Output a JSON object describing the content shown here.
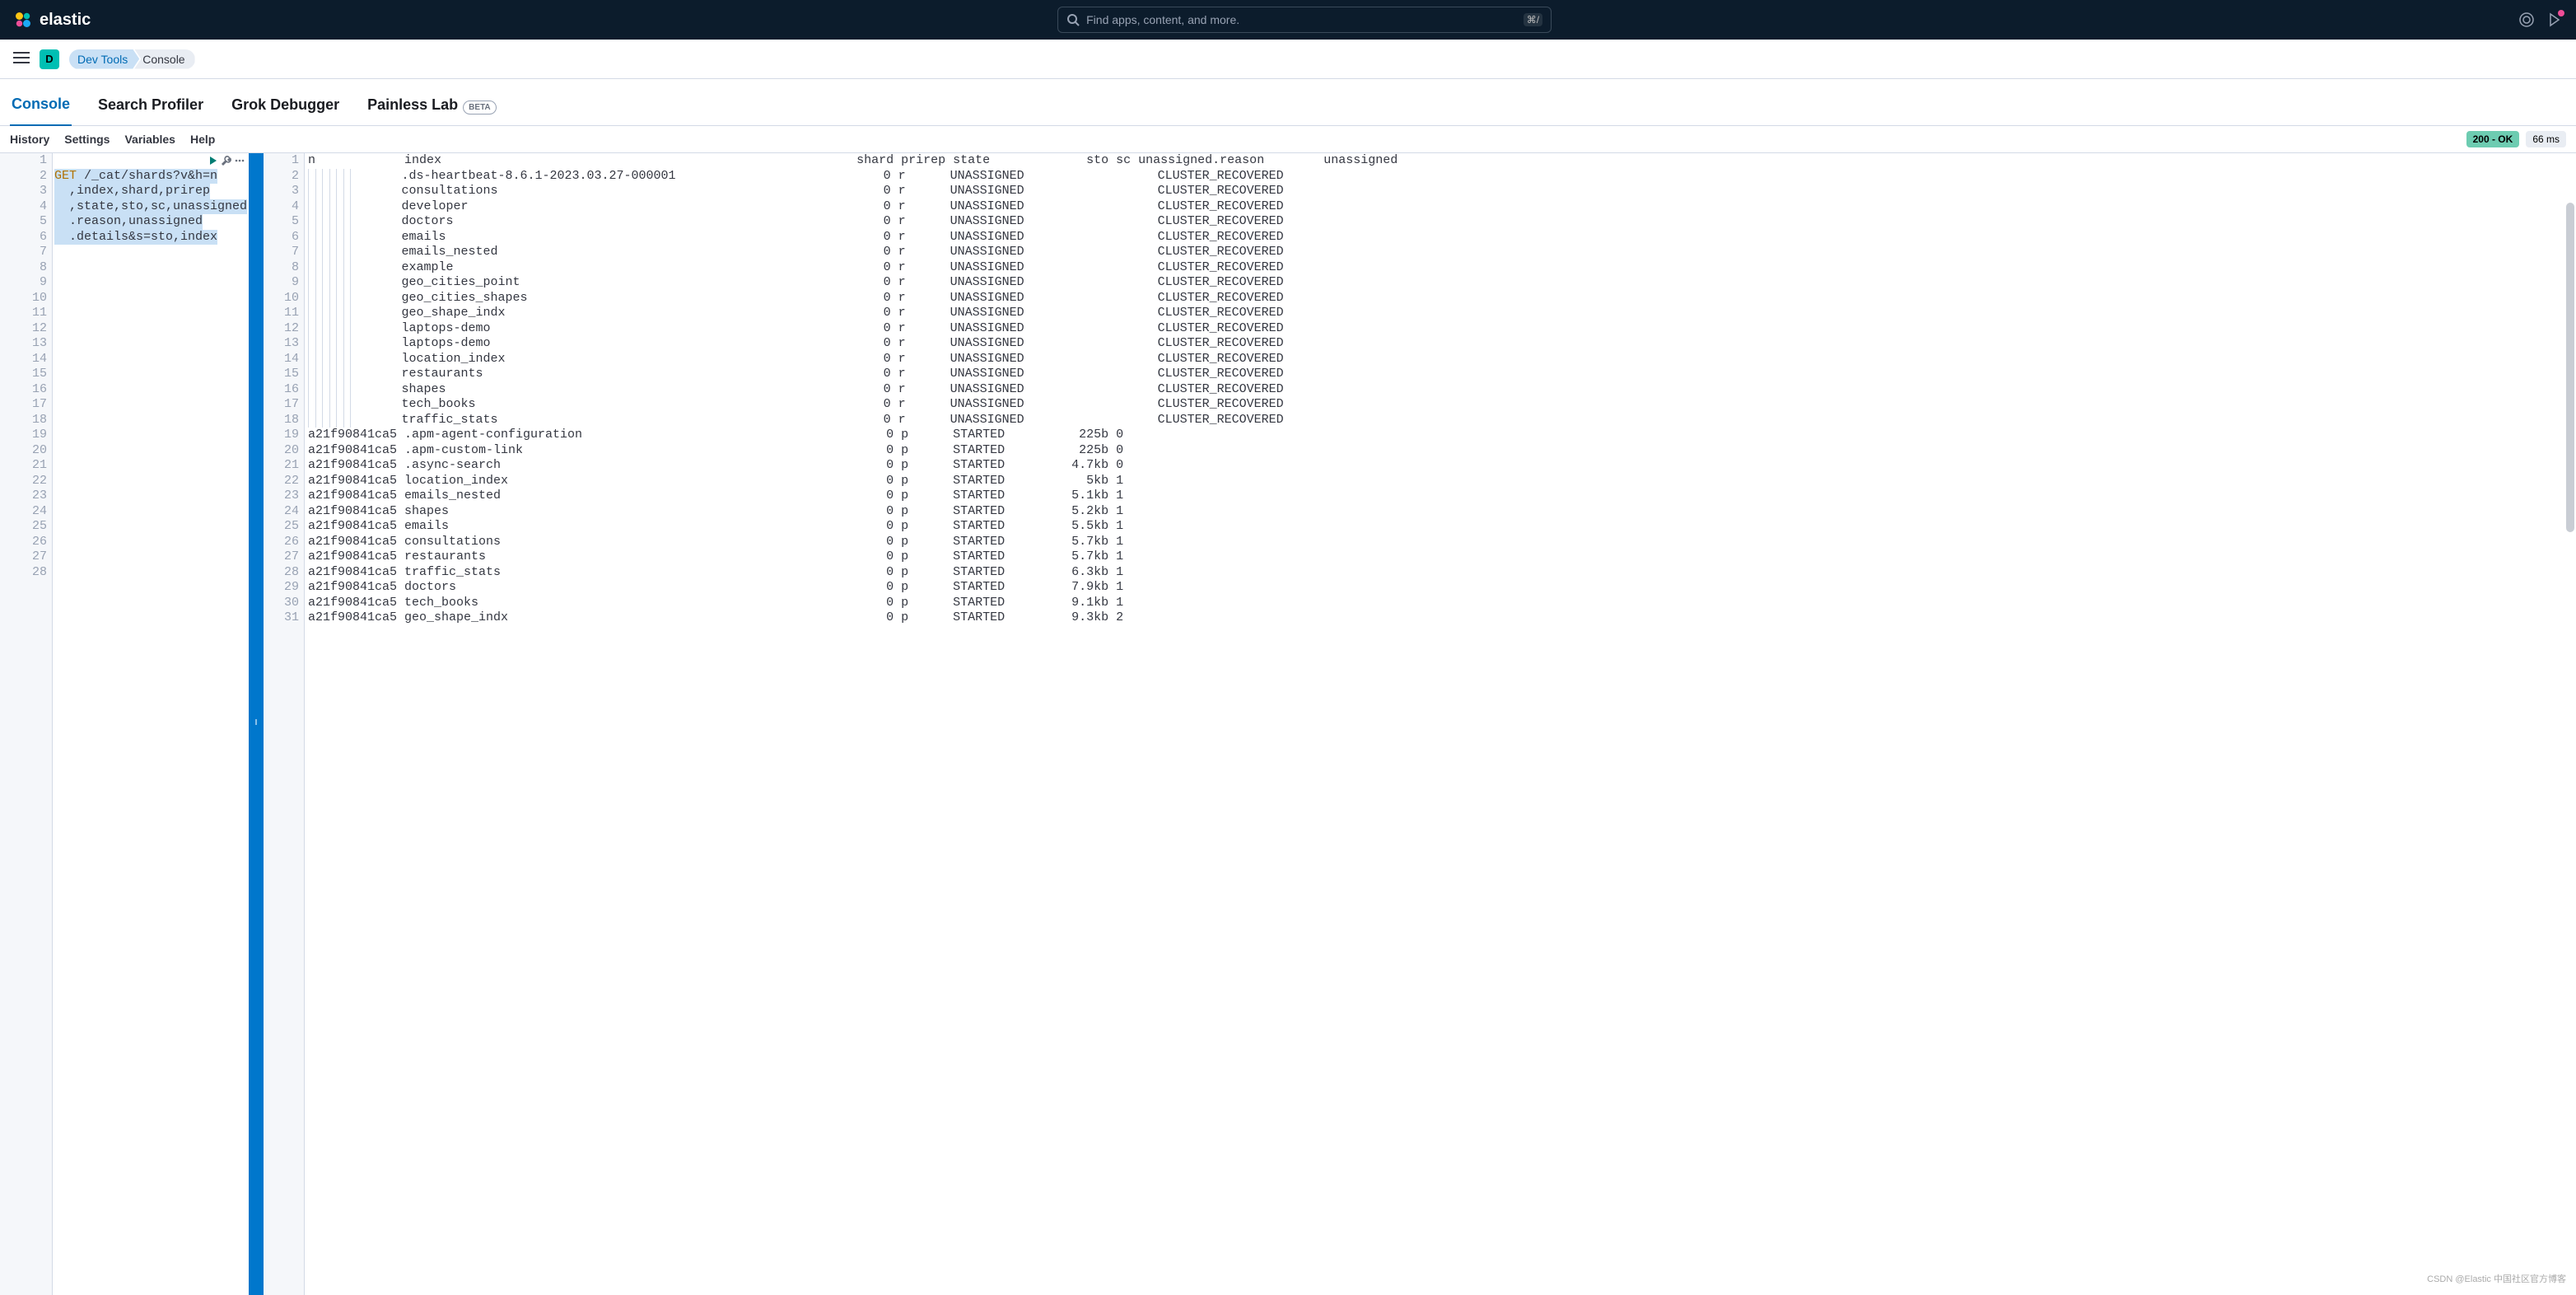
{
  "header": {
    "brand": "elastic",
    "search_placeholder": "Find apps, content, and more.",
    "search_shortcut": "⌘/"
  },
  "subbar": {
    "avatar": "D",
    "breadcrumbs": [
      "Dev Tools",
      "Console"
    ]
  },
  "tabs": {
    "items": [
      "Console",
      "Search Profiler",
      "Grok Debugger",
      "Painless Lab"
    ],
    "beta_label": "BETA",
    "active": 0
  },
  "toolbar": {
    "links": [
      "History",
      "Settings",
      "Variables",
      "Help"
    ],
    "status": "200 - OK",
    "time": "66 ms"
  },
  "request": {
    "total_lines": 28,
    "lines": [
      "",
      {
        "method": "GET",
        "path": " /_cat/shards?v&h=n"
      },
      "  ,index,shard,prirep",
      "  ,state,sto,sc,unassigned",
      "  .reason,unassigned",
      "  .details&s=sto,index"
    ]
  },
  "response": {
    "cols": {
      "n": "n",
      "index": "index",
      "shard": "shard",
      "prirep": "prirep",
      "state": "state",
      "sto": "sto",
      "sc": "sc",
      "ur": "unassigned.reason",
      "ud": "unassigned"
    },
    "header_continuation": ".details",
    "rows": [
      {
        "n": "",
        "index": ".ds-heartbeat-8.6.1-2023.03.27-000001",
        "shard": "0",
        "prirep": "r",
        "state": "UNASSIGNED",
        "sto": "",
        "sc": "",
        "ur": "CLUSTER_RECOVERED",
        "ud": "",
        "indent": true
      },
      {
        "n": "",
        "index": "consultations",
        "shard": "0",
        "prirep": "r",
        "state": "UNASSIGNED",
        "sto": "",
        "sc": "",
        "ur": "CLUSTER_RECOVERED",
        "ud": "",
        "indent": true
      },
      {
        "n": "",
        "index": "developer",
        "shard": "0",
        "prirep": "r",
        "state": "UNASSIGNED",
        "sto": "",
        "sc": "",
        "ur": "CLUSTER_RECOVERED",
        "ud": "",
        "indent": true
      },
      {
        "n": "",
        "index": "doctors",
        "shard": "0",
        "prirep": "r",
        "state": "UNASSIGNED",
        "sto": "",
        "sc": "",
        "ur": "CLUSTER_RECOVERED",
        "ud": "",
        "indent": true
      },
      {
        "n": "",
        "index": "emails",
        "shard": "0",
        "prirep": "r",
        "state": "UNASSIGNED",
        "sto": "",
        "sc": "",
        "ur": "CLUSTER_RECOVERED",
        "ud": "",
        "indent": true
      },
      {
        "n": "",
        "index": "emails_nested",
        "shard": "0",
        "prirep": "r",
        "state": "UNASSIGNED",
        "sto": "",
        "sc": "",
        "ur": "CLUSTER_RECOVERED",
        "ud": "",
        "indent": true
      },
      {
        "n": "",
        "index": "example",
        "shard": "0",
        "prirep": "r",
        "state": "UNASSIGNED",
        "sto": "",
        "sc": "",
        "ur": "CLUSTER_RECOVERED",
        "ud": "",
        "indent": true
      },
      {
        "n": "",
        "index": "geo_cities_point",
        "shard": "0",
        "prirep": "r",
        "state": "UNASSIGNED",
        "sto": "",
        "sc": "",
        "ur": "CLUSTER_RECOVERED",
        "ud": "",
        "indent": true
      },
      {
        "n": "",
        "index": "geo_cities_shapes",
        "shard": "0",
        "prirep": "r",
        "state": "UNASSIGNED",
        "sto": "",
        "sc": "",
        "ur": "CLUSTER_RECOVERED",
        "ud": "",
        "indent": true
      },
      {
        "n": "",
        "index": "geo_shape_indx",
        "shard": "0",
        "prirep": "r",
        "state": "UNASSIGNED",
        "sto": "",
        "sc": "",
        "ur": "CLUSTER_RECOVERED",
        "ud": "",
        "indent": true
      },
      {
        "n": "",
        "index": "laptops-demo",
        "shard": "0",
        "prirep": "r",
        "state": "UNASSIGNED",
        "sto": "",
        "sc": "",
        "ur": "CLUSTER_RECOVERED",
        "ud": "",
        "indent": true
      },
      {
        "n": "",
        "index": "laptops-demo",
        "shard": "0",
        "prirep": "r",
        "state": "UNASSIGNED",
        "sto": "",
        "sc": "",
        "ur": "CLUSTER_RECOVERED",
        "ud": "",
        "indent": true
      },
      {
        "n": "",
        "index": "location_index",
        "shard": "0",
        "prirep": "r",
        "state": "UNASSIGNED",
        "sto": "",
        "sc": "",
        "ur": "CLUSTER_RECOVERED",
        "ud": "",
        "indent": true
      },
      {
        "n": "",
        "index": "restaurants",
        "shard": "0",
        "prirep": "r",
        "state": "UNASSIGNED",
        "sto": "",
        "sc": "",
        "ur": "CLUSTER_RECOVERED",
        "ud": "",
        "indent": true
      },
      {
        "n": "",
        "index": "shapes",
        "shard": "0",
        "prirep": "r",
        "state": "UNASSIGNED",
        "sto": "",
        "sc": "",
        "ur": "CLUSTER_RECOVERED",
        "ud": "",
        "indent": true
      },
      {
        "n": "",
        "index": "tech_books",
        "shard": "0",
        "prirep": "r",
        "state": "UNASSIGNED",
        "sto": "",
        "sc": "",
        "ur": "CLUSTER_RECOVERED",
        "ud": "",
        "indent": true
      },
      {
        "n": "",
        "index": "traffic_stats",
        "shard": "0",
        "prirep": "r",
        "state": "UNASSIGNED",
        "sto": "",
        "sc": "",
        "ur": "CLUSTER_RECOVERED",
        "ud": "",
        "indent": true
      },
      {
        "n": "a21f90841ca5",
        "index": ".apm-agent-configuration",
        "shard": "0",
        "prirep": "p",
        "state": "STARTED",
        "sto": "225b",
        "sc": "0",
        "ur": "",
        "ud": "",
        "indent": false
      },
      {
        "n": "a21f90841ca5",
        "index": ".apm-custom-link",
        "shard": "0",
        "prirep": "p",
        "state": "STARTED",
        "sto": "225b",
        "sc": "0",
        "ur": "",
        "ud": "",
        "indent": false
      },
      {
        "n": "a21f90841ca5",
        "index": ".async-search",
        "shard": "0",
        "prirep": "p",
        "state": "STARTED",
        "sto": "4.7kb",
        "sc": "0",
        "ur": "",
        "ud": "",
        "indent": false
      },
      {
        "n": "a21f90841ca5",
        "index": "location_index",
        "shard": "0",
        "prirep": "p",
        "state": "STARTED",
        "sto": "5kb",
        "sc": "1",
        "ur": "",
        "ud": "",
        "indent": false
      },
      {
        "n": "a21f90841ca5",
        "index": "emails_nested",
        "shard": "0",
        "prirep": "p",
        "state": "STARTED",
        "sto": "5.1kb",
        "sc": "1",
        "ur": "",
        "ud": "",
        "indent": false
      },
      {
        "n": "a21f90841ca5",
        "index": "shapes",
        "shard": "0",
        "prirep": "p",
        "state": "STARTED",
        "sto": "5.2kb",
        "sc": "1",
        "ur": "",
        "ud": "",
        "indent": false
      },
      {
        "n": "a21f90841ca5",
        "index": "emails",
        "shard": "0",
        "prirep": "p",
        "state": "STARTED",
        "sto": "5.5kb",
        "sc": "1",
        "ur": "",
        "ud": "",
        "indent": false
      },
      {
        "n": "a21f90841ca5",
        "index": "consultations",
        "shard": "0",
        "prirep": "p",
        "state": "STARTED",
        "sto": "5.7kb",
        "sc": "1",
        "ur": "",
        "ud": "",
        "indent": false
      },
      {
        "n": "a21f90841ca5",
        "index": "restaurants",
        "shard": "0",
        "prirep": "p",
        "state": "STARTED",
        "sto": "5.7kb",
        "sc": "1",
        "ur": "",
        "ud": "",
        "indent": false
      },
      {
        "n": "a21f90841ca5",
        "index": "traffic_stats",
        "shard": "0",
        "prirep": "p",
        "state": "STARTED",
        "sto": "6.3kb",
        "sc": "1",
        "ur": "",
        "ud": "",
        "indent": false
      },
      {
        "n": "a21f90841ca5",
        "index": "doctors",
        "shard": "0",
        "prirep": "p",
        "state": "STARTED",
        "sto": "7.9kb",
        "sc": "1",
        "ur": "",
        "ud": "",
        "indent": false
      },
      {
        "n": "a21f90841ca5",
        "index": "tech_books",
        "shard": "0",
        "prirep": "p",
        "state": "STARTED",
        "sto": "9.1kb",
        "sc": "1",
        "ur": "",
        "ud": "",
        "indent": false
      },
      {
        "n": "a21f90841ca5",
        "index": "geo_shape_indx",
        "shard": "0",
        "prirep": "p",
        "state": "STARTED",
        "sto": "9.3kb",
        "sc": "2",
        "ur": "",
        "ud": "",
        "indent": false
      }
    ]
  },
  "watermark": "CSDN @Elastic 中国社区官方博客"
}
